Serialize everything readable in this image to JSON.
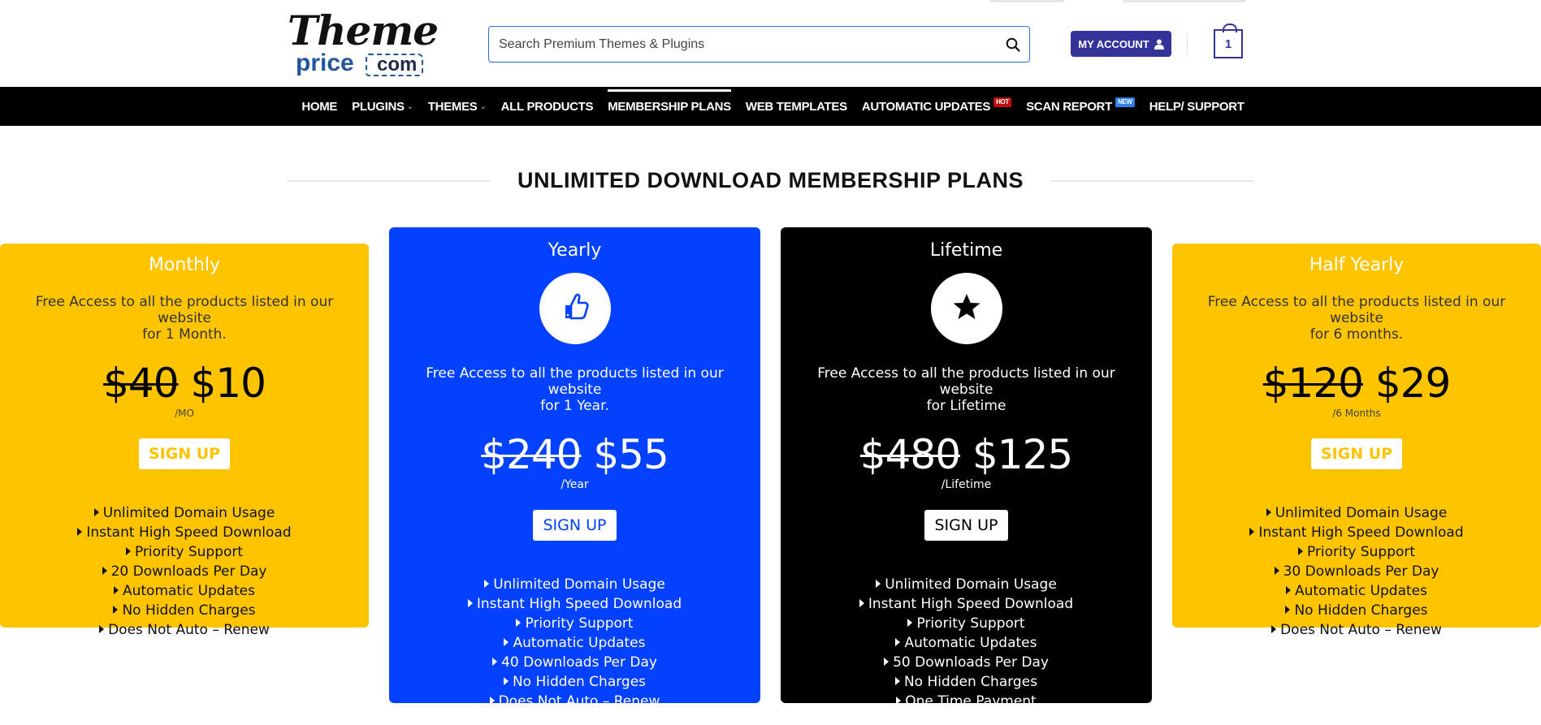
{
  "header": {
    "logo_line1": "Theme",
    "logo_line2": "price",
    "logo_tag": "com",
    "search_placeholder": "Search Premium Themes & Plugins",
    "account_label": "MY ACCOUNT",
    "cart_count": "1"
  },
  "nav": {
    "items": [
      {
        "label": "HOME"
      },
      {
        "label": "PLUGINS",
        "caret": "⌄"
      },
      {
        "label": "THEMES",
        "caret": "⌄"
      },
      {
        "label": "ALL PRODUCTS"
      },
      {
        "label": "MEMBERSHIP PLANS",
        "active": true
      },
      {
        "label": "WEB TEMPLATES"
      },
      {
        "label": "AUTOMATIC UPDATES",
        "badge": "HOT"
      },
      {
        "label": "SCAN REPORT",
        "badge": "NEW"
      },
      {
        "label": "HELP/ SUPPORT"
      }
    ]
  },
  "section_title": "UNLIMITED DOWNLOAD MEMBERSHIP PLANS",
  "plans": [
    {
      "title": "Monthly",
      "desc_line1": "Free Access to all the products listed in our website",
      "desc_line2": "for 1 Month.",
      "old_price": "$40",
      "price": "$10",
      "period": "/MO",
      "button": "SIGN UP",
      "features": [
        "Unlimited Domain Usage",
        "Instant High Speed Download",
        "Priority Support",
        "20 Downloads Per Day",
        "Automatic Updates",
        "No Hidden Charges",
        "Does Not Auto – Renew"
      ]
    },
    {
      "title": "Yearly",
      "icon": "thumbs-up-icon",
      "desc_line1": "Free Access to all the products listed in our website",
      "desc_line2": "for 1 Year.",
      "old_price": "$240",
      "price": "$55",
      "period": "/Year",
      "button": "SIGN UP",
      "features": [
        "Unlimited Domain Usage",
        "Instant High Speed Download",
        "Priority Support",
        "Automatic Updates",
        "40 Downloads Per Day",
        "No Hidden Charges",
        "Does Not Auto – Renew"
      ]
    },
    {
      "title": "Lifetime",
      "icon": "star-icon",
      "desc_line1": "Free Access to all the products listed in our website",
      "desc_line2": "for Lifetime",
      "old_price": "$480",
      "price": "$125",
      "period": "/Lifetime",
      "button": "SIGN UP",
      "features": [
        "Unlimited Domain Usage",
        "Instant High Speed Download",
        "Priority Support",
        "Automatic Updates",
        "50 Downloads Per Day",
        "No Hidden Charges",
        "One Time Payment"
      ]
    },
    {
      "title": "Half Yearly",
      "desc_line1": "Free Access to all the products listed in our website",
      "desc_line2": "for 6 months.",
      "old_price": "$120",
      "price": "$29",
      "period": "/6 Months",
      "button": "SIGN UP",
      "features": [
        "Unlimited Domain Usage",
        "Instant High Speed Download",
        "Priority Support",
        "30 Downloads Per Day",
        "Automatic Updates",
        "No Hidden Charges",
        "Does Not Auto – Renew"
      ]
    }
  ],
  "colors": {
    "gold": "#ffc400",
    "blue": "#0242ff",
    "black": "#000000",
    "account": "#333399",
    "hot_badge": "#c00d0d",
    "new_badge": "#2f80ed"
  }
}
